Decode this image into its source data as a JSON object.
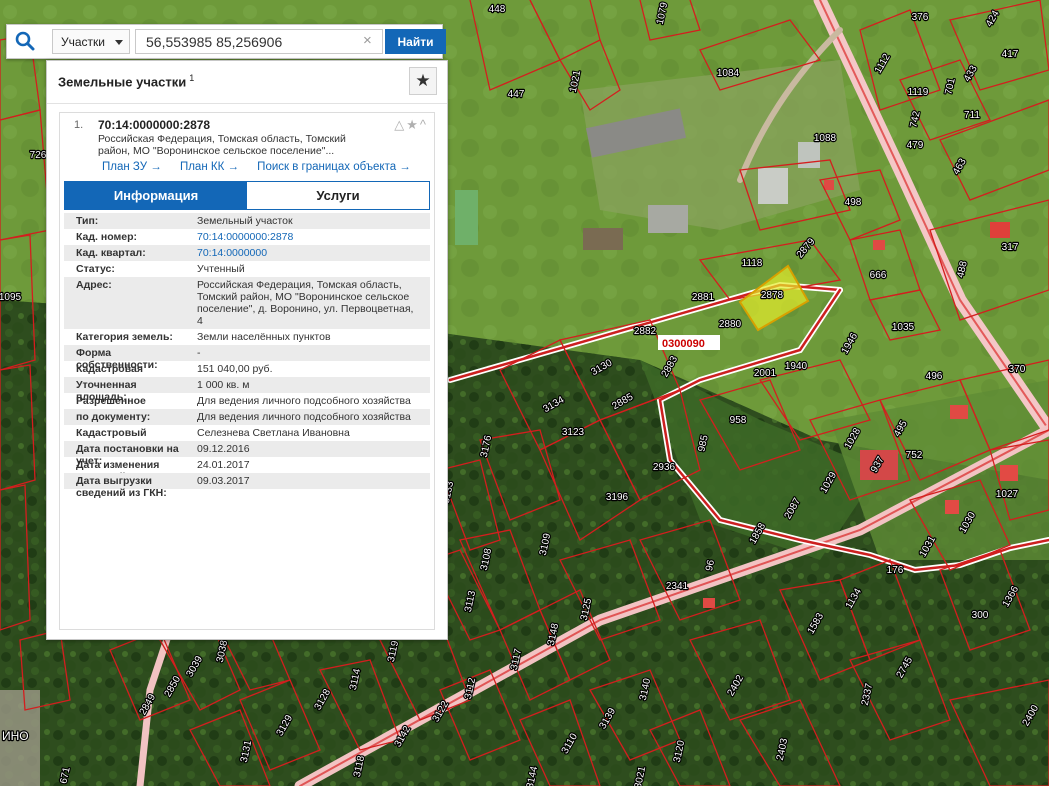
{
  "search": {
    "layer_select": "Участки",
    "query": "56,553985 85,256906",
    "find_label": "Найти",
    "clear_glyph": "×"
  },
  "panel": {
    "title": "Земельные участки",
    "count": "1",
    "star_glyph": "★",
    "item": {
      "index": "1.",
      "cad_number": "70:14:0000000:2878",
      "actions": "△★^",
      "address": "Российская Федерация, Томская область, Томский район, МО \"Воронинское сельское поселение\"...",
      "links": [
        "План ЗУ →",
        "План КК →",
        "Поиск в границах объекта →"
      ],
      "tabs": {
        "info": "Информация",
        "services": "Услуги"
      },
      "fields": [
        {
          "k": "Тип:",
          "v": "Земельный участок"
        },
        {
          "k": "Кад. номер:",
          "v": "70:14:0000000:2878",
          "link": true
        },
        {
          "k": "Кад. квартал:",
          "v": "70:14:0000000",
          "link": true
        },
        {
          "k": "Статус:",
          "v": "Учтенный"
        },
        {
          "k": "Адрес:",
          "v": "Российская Федерация, Томская область, Томский район, МО \"Воронинское сельское поселение\", д. Воронино, ул. Первоцветная, 4"
        },
        {
          "k": "Категория земель:",
          "v": "Земли населённых пунктов"
        },
        {
          "k": "Форма собственности:",
          "v": "-"
        },
        {
          "k": "Кадастровая стоимость:",
          "v": "151 040,00 руб."
        },
        {
          "k": "Уточненная площадь:",
          "v": "1 000 кв. м"
        },
        {
          "k": "Разрешенное использование:",
          "v": "Для ведения личного подсобного хозяйства"
        },
        {
          "k": "по документу:",
          "v": "Для ведения личного подсобного хозяйства"
        },
        {
          "k": "Кадастровый инженер:",
          "v": "Селезнева Светлана Ивановна"
        },
        {
          "k": "Дата постановки на учет:",
          "v": "09.12.2016"
        },
        {
          "k": "Дата изменения сведений в ГКН:",
          "v": "24.01.2017"
        },
        {
          "k": "Дата выгрузки сведений из ГКН:",
          "v": "09.03.2017"
        }
      ]
    }
  },
  "map": {
    "quarter_label": "0300090",
    "selected_parcel": "2878",
    "village_fragment": "ИНО",
    "parcel_labels": [
      "448",
      "1079",
      "376",
      "424",
      "447",
      "1021",
      "1084",
      "1112",
      "433",
      "417",
      "701",
      "1119",
      "742",
      "711",
      "726",
      "1088",
      "479",
      "463",
      "498",
      "317",
      "488",
      "666",
      "1118",
      "2879",
      "2881",
      "2878",
      "1095",
      "1035",
      "2882",
      "2880",
      "1946",
      "370",
      "2883",
      "2001",
      "496",
      "3130",
      "1940",
      "3134",
      "2885",
      "958",
      "1028",
      "495",
      "752",
      "3123",
      "2936",
      "985",
      "937",
      "3176",
      "3196",
      "1029",
      "1027",
      "1030",
      "3133",
      "3109",
      "2087",
      "1031",
      "3108",
      "1858",
      "176",
      "1366",
      "2341",
      "96",
      "300",
      "1134",
      "3125",
      "3113",
      "1583",
      "2745",
      "3148",
      "3117",
      "3119",
      "3112",
      "2850",
      "3039",
      "3038",
      "2849",
      "3114",
      "3128",
      "3140",
      "3122",
      "3129",
      "2402",
      "2337",
      "2400",
      "3142",
      "3139",
      "3131",
      "3110",
      "3120",
      "3118",
      "3144",
      "3021",
      "2403",
      "671"
    ]
  }
}
